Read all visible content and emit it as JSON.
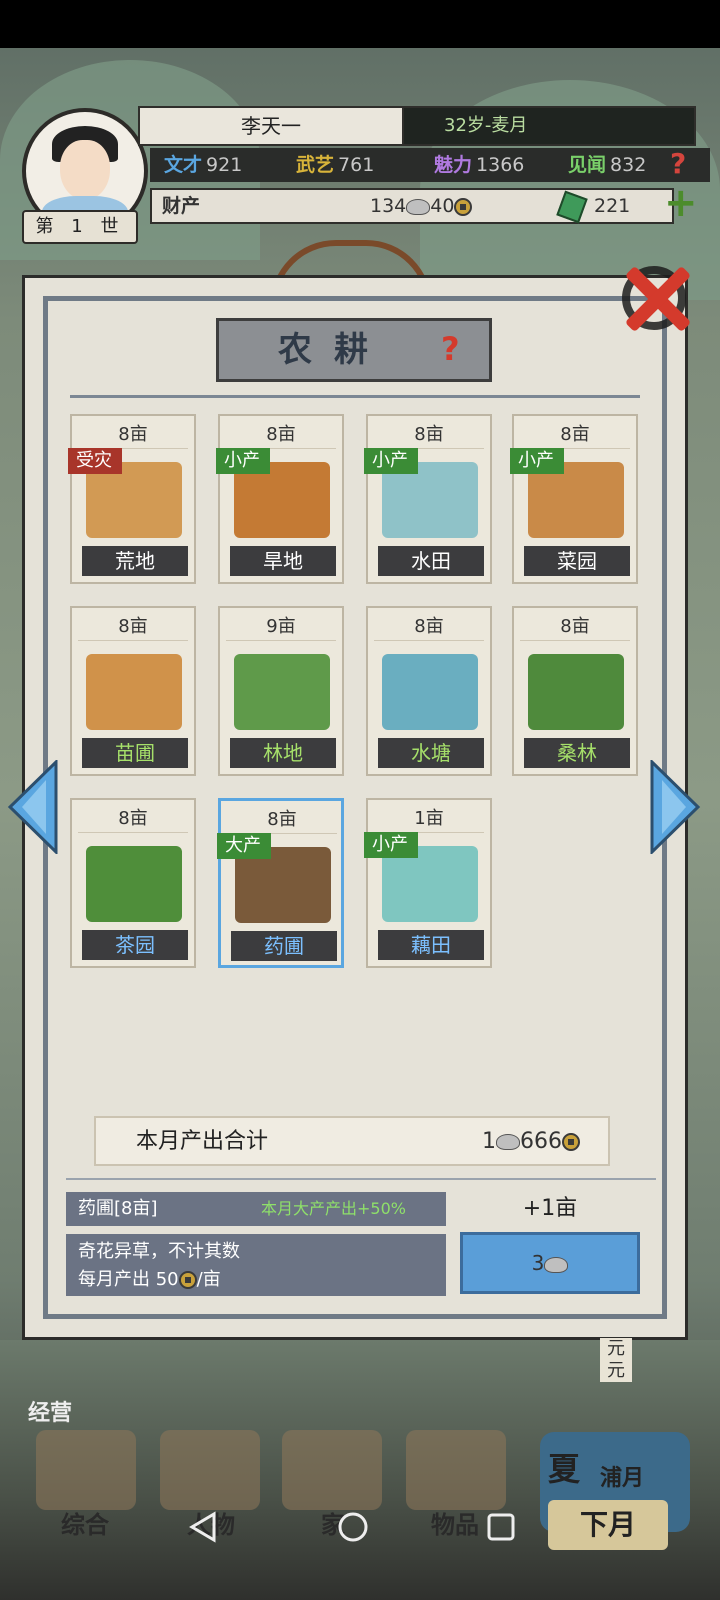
{
  "character": {
    "name": "李天一",
    "age_period": "32岁-麦月",
    "life": "第 1 世",
    "stats": [
      {
        "label": "文才",
        "value": "921",
        "color": "#5aa6e0"
      },
      {
        "label": "武艺",
        "value": "761",
        "color": "#d8b43a"
      },
      {
        "label": "魅力",
        "value": "1366",
        "color": "#b07ae0"
      },
      {
        "label": "见闻",
        "value": "832",
        "color": "#7ad06a"
      }
    ],
    "wealth_label": "财产",
    "silver": "134",
    "copper": "40",
    "jade": "221"
  },
  "panel": {
    "title": "农耕"
  },
  "plots": [
    {
      "acres": "8亩",
      "name": "荒地",
      "badge": "受灾",
      "badge_type": "disaster",
      "label_color": "white",
      "art": "barren-land-icon",
      "art_color": "#d29a54",
      "selected": false
    },
    {
      "acres": "8亩",
      "name": "旱地",
      "badge": "小产",
      "badge_type": "small",
      "label_color": "white",
      "art": "dry-land-icon",
      "art_color": "#c47a34",
      "selected": false
    },
    {
      "acres": "8亩",
      "name": "水田",
      "badge": "小产",
      "badge_type": "small",
      "label_color": "white",
      "art": "paddy-field-icon",
      "art_color": "#8fc2c8",
      "selected": false
    },
    {
      "acres": "8亩",
      "name": "菜园",
      "badge": "小产",
      "badge_type": "small",
      "label_color": "white",
      "art": "vegetable-garden-icon",
      "art_color": "#c98a48",
      "selected": false
    },
    {
      "acres": "8亩",
      "name": "苗圃",
      "badge": "",
      "badge_type": "",
      "label_color": "green",
      "art": "nursery-icon",
      "art_color": "#d0924a",
      "selected": false
    },
    {
      "acres": "9亩",
      "name": "林地",
      "badge": "",
      "badge_type": "",
      "label_color": "green",
      "art": "woodland-icon",
      "art_color": "#5f9a4a",
      "selected": false
    },
    {
      "acres": "8亩",
      "name": "水塘",
      "badge": "",
      "badge_type": "",
      "label_color": "green",
      "art": "pond-icon",
      "art_color": "#6aaec0",
      "selected": false
    },
    {
      "acres": "8亩",
      "name": "桑林",
      "badge": "",
      "badge_type": "",
      "label_color": "green",
      "art": "mulberry-grove-icon",
      "art_color": "#4f8a3c",
      "selected": false
    },
    {
      "acres": "8亩",
      "name": "茶园",
      "badge": "",
      "badge_type": "",
      "label_color": "blue",
      "art": "tea-garden-icon",
      "art_color": "#4f8e3a",
      "selected": false
    },
    {
      "acres": "8亩",
      "name": "药圃",
      "badge": "大产",
      "badge_type": "big",
      "label_color": "blue",
      "art": "herb-garden-icon",
      "art_color": "#7a5a3a",
      "selected": true
    },
    {
      "acres": "1亩",
      "name": "藕田",
      "badge": "小产",
      "badge_type": "small",
      "label_color": "blue",
      "art": "lotus-field-icon",
      "art_color": "#7fc6c0",
      "selected": false
    }
  ],
  "summary": {
    "label": "本月产出合计",
    "silver": "1",
    "copper": "666"
  },
  "selected_info": {
    "name": "药圃[8亩]",
    "bonus": "本月大产产出+50%",
    "desc_line1": "奇花异草，不计其数",
    "desc_line2_prefix": "每月产出 50",
    "desc_line2_suffix": "/亩",
    "plus_acre": "+1亩",
    "buy_cost": "3"
  },
  "bottom": {
    "manage": "经营",
    "menu": [
      "综合",
      "人物",
      "家",
      "物品"
    ],
    "season": "夏",
    "month": "浦月",
    "next_month": "下月",
    "side_text": "元元"
  }
}
